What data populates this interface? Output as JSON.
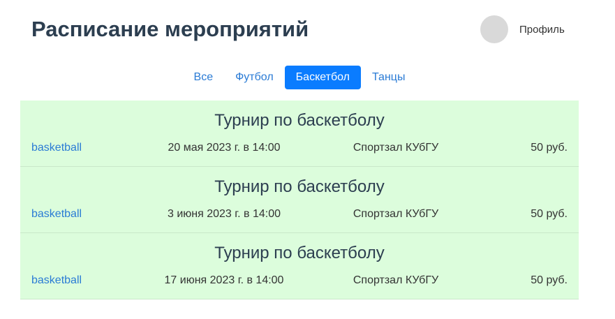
{
  "header": {
    "title": "Расписание мероприятий",
    "profile_label": "Профиль"
  },
  "tabs": [
    {
      "label": "Все",
      "active": false
    },
    {
      "label": "Футбол",
      "active": false
    },
    {
      "label": "Баскетбол",
      "active": true
    },
    {
      "label": "Танцы",
      "active": false
    }
  ],
  "events": [
    {
      "title": "Турнир по баскетболу",
      "tag": "basketball",
      "date": "20 мая 2023 г. в 14:00",
      "place": "Спортзал КУбГУ",
      "price": "50 руб."
    },
    {
      "title": "Турнир по баскетболу",
      "tag": "basketball",
      "date": "3 июня 2023 г. в 14:00",
      "place": "Спортзал КУбГУ",
      "price": "50 руб."
    },
    {
      "title": "Турнир по баскетболу",
      "tag": "basketball",
      "date": "17 июня 2023 г. в 14:00",
      "place": "Спортзал КУбГУ",
      "price": "50 руб."
    }
  ],
  "colors": {
    "accent": "#0a7cff",
    "link": "#2a7bd5",
    "card_background": "#dcfddc",
    "heading": "#2c3e50"
  }
}
